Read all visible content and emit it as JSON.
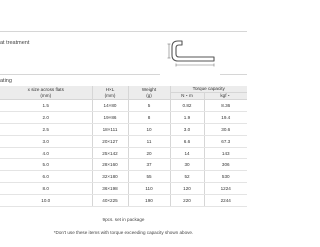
{
  "spec": {
    "treatment_text": "at treatment"
  },
  "coating_text": "ating",
  "table": {
    "headers": {
      "size": [
        "x size across flats",
        "(mm)"
      ],
      "dims": [
        "H×L",
        "(mm)"
      ],
      "weight": [
        "Weight",
        "(g)"
      ],
      "torque": "Torque capacity",
      "torque_nm": "N・m",
      "torque_kgf": "kgf・"
    },
    "rows": [
      {
        "size": "1.5",
        "dims": "14×80",
        "weight": "5",
        "nm": "0.82",
        "kgf": "8.36"
      },
      {
        "size": "2.0",
        "dims": "19×86",
        "weight": "8",
        "nm": "1.9",
        "kgf": "19.4"
      },
      {
        "size": "2.5",
        "dims": "18×111",
        "weight": "10",
        "nm": "3.0",
        "kgf": "30.6"
      },
      {
        "size": "3.0",
        "dims": "20×127",
        "weight": "11",
        "nm": "6.6",
        "kgf": "67.3"
      },
      {
        "size": "4.0",
        "dims": "25×142",
        "weight": "20",
        "nm": "14",
        "kgf": "143"
      },
      {
        "size": "5.0",
        "dims": "28×160",
        "weight": "37",
        "nm": "30",
        "kgf": "306"
      },
      {
        "size": "6.0",
        "dims": "32×180",
        "weight": "55",
        "nm": "52",
        "kgf": "530"
      },
      {
        "size": "8.0",
        "dims": "36×198",
        "weight": "110",
        "nm": "120",
        "kgf": "1224"
      },
      {
        "size": "10.0",
        "dims": "40×225",
        "weight": "190",
        "nm": "220",
        "kgf": "2244"
      }
    ]
  },
  "footnote": "9pcs. set in package",
  "disclaimer": "*Don't use these items with torque exceeding capacity shown above."
}
